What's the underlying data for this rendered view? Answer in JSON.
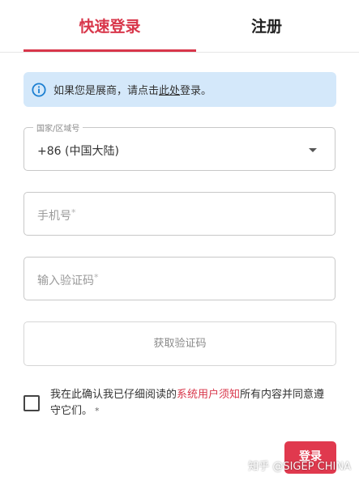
{
  "tabs": {
    "login_label": "快速登录",
    "register_label": "注册"
  },
  "info": {
    "icon": "info-icon",
    "text_before": "如果您是展商，请点击",
    "link_label": "此处",
    "text_after": "登录。"
  },
  "country_field": {
    "label": "国家/区域号",
    "value": "+86 (中国大陆)",
    "icon": "chevron-down-icon"
  },
  "phone_field": {
    "placeholder": "手机号",
    "required_mark": "*"
  },
  "code_field": {
    "placeholder": "输入验证码",
    "required_mark": "*"
  },
  "get_code_button": {
    "label": "获取验证码"
  },
  "consent": {
    "checked": false,
    "text_before": "我在此确认我已仔细阅读的",
    "link_label": "系统用户须知",
    "text_after": "所有内容并同意遵守它们。",
    "required_mark": "*"
  },
  "login_button": {
    "label": "登录"
  },
  "watermark": {
    "text": "知乎 @SIGEP CHINA"
  },
  "colors": {
    "accent": "#d8364a",
    "info_bg": "#d4e8fa",
    "info_icon": "#1b7fd1",
    "border": "#c8c8c8"
  }
}
